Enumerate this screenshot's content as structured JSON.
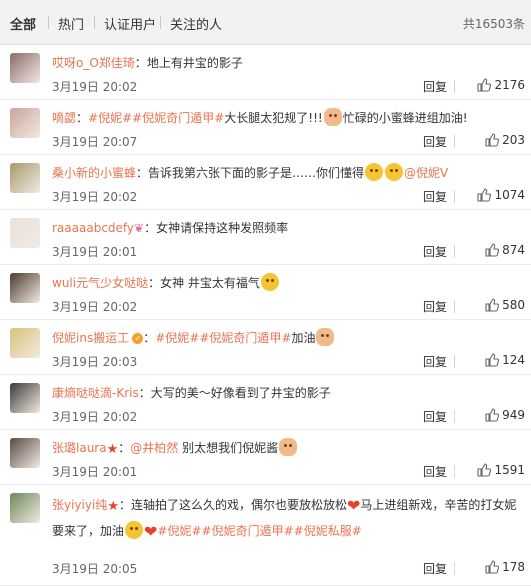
{
  "tabs": [
    {
      "label": "全部"
    },
    {
      "label": "热门"
    },
    {
      "label": "认证用户"
    },
    {
      "label": "关注的人"
    }
  ],
  "total": "共16503条",
  "reply_label": "回复",
  "comments": [
    {
      "user": "哎呀o_O郑佳琦",
      "sep": "：",
      "parts": [
        {
          "t": "text",
          "v": "地上有井宝的影子"
        }
      ],
      "time": "3月19日 20:02",
      "likes": "2176",
      "avatar": "#8a6b6b"
    },
    {
      "user": "嘀勰",
      "sep": "：",
      "parts": [
        {
          "t": "tag",
          "v": "#倪妮#"
        },
        {
          "t": "tag",
          "v": "#倪妮奇门遁甲#"
        },
        {
          "t": "text",
          "v": "大长腿太犯规了!!!"
        },
        {
          "t": "emoji",
          "v": "hand"
        },
        {
          "t": "text",
          "v": "忙碌的小蜜蜂进组加油!"
        }
      ],
      "time": "3月19日 20:07",
      "likes": "203",
      "avatar": "#c9a59a"
    },
    {
      "user": "桑小新的小蜜蜂",
      "sep": "：",
      "parts": [
        {
          "t": "text",
          "v": "告诉我第六张下面的影子是……你们懂得"
        },
        {
          "t": "emoji",
          "v": "dog"
        },
        {
          "t": "emoji",
          "v": "dog"
        },
        {
          "t": "tag",
          "v": "@倪妮V"
        }
      ],
      "time": "3月19日 20:02",
      "likes": "1074",
      "avatar": "#a89a6a"
    },
    {
      "user": "raaaaabcdefy",
      "sep": "：",
      "parts": [
        {
          "t": "text",
          "v": "女神请保持这种发照频率"
        }
      ],
      "time": "3月19日 20:01",
      "likes": "874",
      "avatar": "#e8e2dc",
      "badge": "bow"
    },
    {
      "user": "wuli元气少女哒哒",
      "sep": "：",
      "parts": [
        {
          "t": "text",
          "v": "女神 井宝太有福气"
        },
        {
          "t": "emoji",
          "v": "smile"
        }
      ],
      "time": "3月19日 20:02",
      "likes": "580",
      "avatar": "#4a3a2a"
    },
    {
      "user": "倪妮ins搬运工",
      "sep": "：",
      "parts": [
        {
          "t": "tag",
          "v": "#倪妮#"
        },
        {
          "t": "tag",
          "v": "#倪妮奇门遁甲#"
        },
        {
          "t": "text",
          "v": "加油"
        },
        {
          "t": "emoji",
          "v": "fist"
        }
      ],
      "time": "3月19日 20:03",
      "likes": "124",
      "avatar": "#d9c27a",
      "badge": "v"
    },
    {
      "user": "康熵哒哒滴-Kris",
      "sep": "：",
      "parts": [
        {
          "t": "text",
          "v": "大写的美～好像看到了井宝的影子"
        }
      ],
      "time": "3月19日 20:02",
      "likes": "949",
      "avatar": "#3d3a36"
    },
    {
      "user": "张璐laura",
      "sep": "：",
      "parts": [
        {
          "t": "tag",
          "v": "@井柏然"
        },
        {
          "t": "text",
          "v": " 别太想我们倪妮酱"
        },
        {
          "t": "emoji",
          "v": "fist"
        }
      ],
      "time": "3月19日 20:01",
      "likes": "1591",
      "avatar": "#5a4a44",
      "badge": "star"
    },
    {
      "user": "张yiyiyi纯",
      "sep": "：",
      "parts": [
        {
          "t": "text",
          "v": "连轴拍了这么久的戏，偶尔也要放松放松"
        },
        {
          "t": "heart",
          "v": "heart"
        },
        {
          "t": "text",
          "v": "马上进组新戏，辛苦的打女妮要来了，加油"
        },
        {
          "t": "emoji",
          "v": "smile"
        },
        {
          "t": "heart",
          "v": "heart"
        },
        {
          "t": "tag",
          "v": "#倪妮#"
        },
        {
          "t": "tag",
          "v": "#倪妮奇门遁甲#"
        },
        {
          "t": "tag",
          "v": "#倪妮私服#"
        }
      ],
      "time": "3月19日 20:05",
      "likes": "178",
      "avatar": "#6a8a5a",
      "badge": "star",
      "multiline": true
    }
  ]
}
